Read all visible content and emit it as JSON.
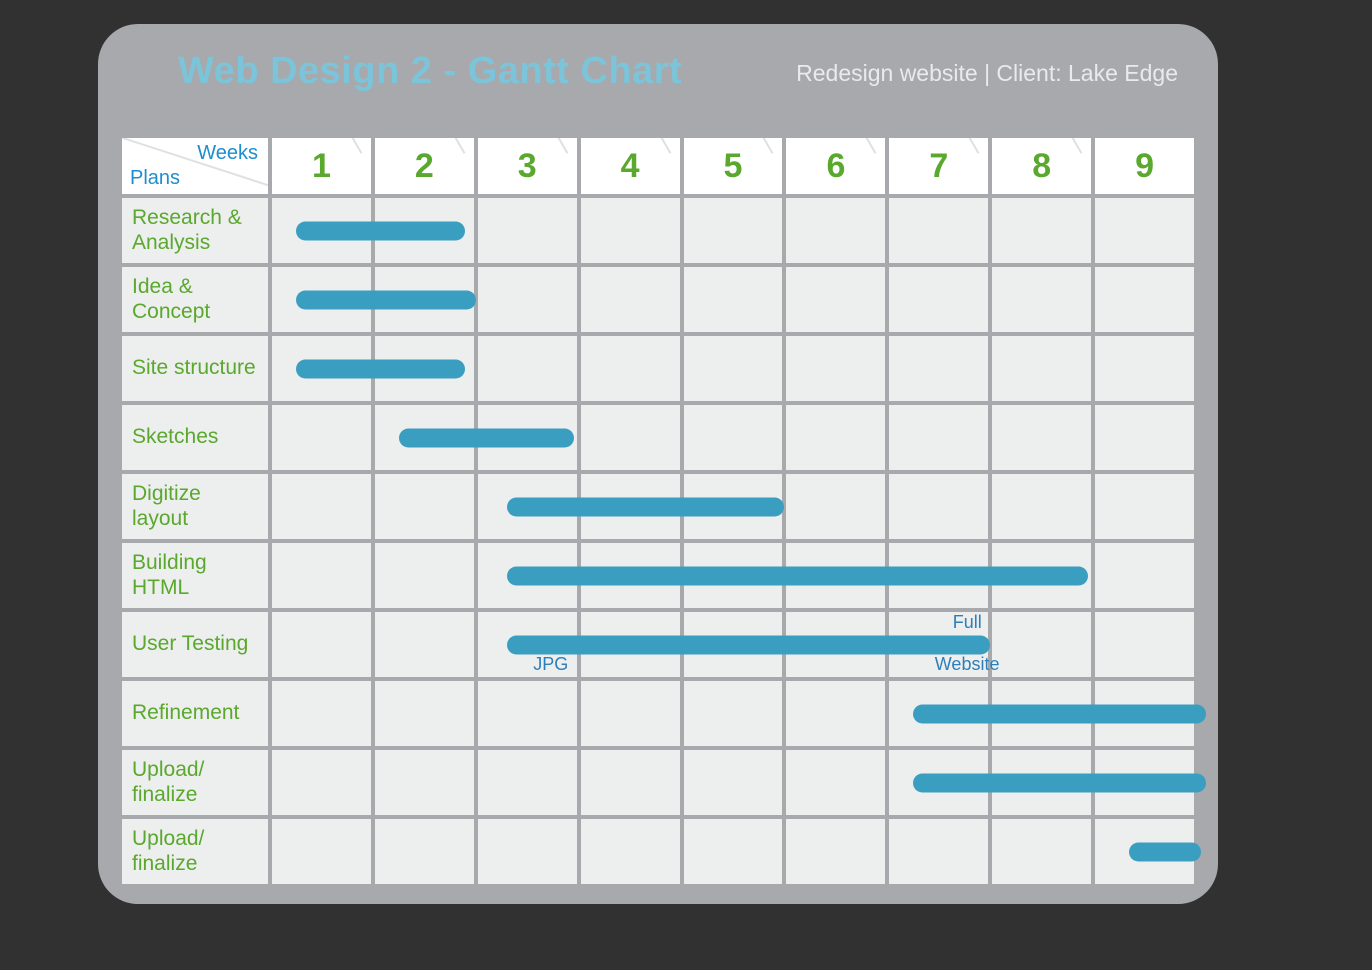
{
  "title": "Web Design 2 - Gantt Chart",
  "subtitle": "Redesign website | Client: Lake Edge",
  "corner": {
    "weeks": "Weeks",
    "plans": "Plans"
  },
  "weeks": [
    "1",
    "2",
    "3",
    "4",
    "5",
    "6",
    "7",
    "8",
    "9"
  ],
  "rows": [
    {
      "label": "Research & Analysis"
    },
    {
      "label": "Idea & Concept"
    },
    {
      "label": "Site structure"
    },
    {
      "label": "Sketches"
    },
    {
      "label": "Digitize layout"
    },
    {
      "label": "Building HTML"
    },
    {
      "label": "User Testing"
    },
    {
      "label": "Refinement"
    },
    {
      "label": "Upload/ finalize"
    },
    {
      "label": "Upload/ finalize"
    }
  ],
  "annotations": {
    "jpg": "JPG",
    "full": "Full",
    "website": "Website"
  },
  "chart_data": {
    "type": "gantt",
    "title": "Web Design 2 - Gantt Chart",
    "xlabel": "Weeks",
    "ylabel": "Plans",
    "x_ticks": [
      1,
      2,
      3,
      4,
      5,
      6,
      7,
      8,
      9
    ],
    "tasks": [
      {
        "name": "Research & Analysis",
        "start": 0.75,
        "end": 2.4
      },
      {
        "name": "Idea & Concept",
        "start": 0.75,
        "end": 2.5
      },
      {
        "name": "Site structure",
        "start": 0.75,
        "end": 2.4
      },
      {
        "name": "Sketches",
        "start": 1.75,
        "end": 3.45
      },
      {
        "name": "Digitize layout",
        "start": 2.8,
        "end": 5.5
      },
      {
        "name": "Building HTML",
        "start": 2.8,
        "end": 8.45
      },
      {
        "name": "User Testing",
        "start": 2.8,
        "end": 7.5,
        "annotations": [
          {
            "text": "JPG",
            "x": 3.0,
            "pos": "below"
          },
          {
            "text": "Full Website",
            "x": 7.0,
            "pos": "around"
          }
        ]
      },
      {
        "name": "Refinement",
        "start": 6.75,
        "end": 9.6
      },
      {
        "name": "Upload/ finalize",
        "start": 6.75,
        "end": 9.6
      },
      {
        "name": "Upload/ finalize",
        "start": 8.85,
        "end": 9.55
      }
    ]
  }
}
